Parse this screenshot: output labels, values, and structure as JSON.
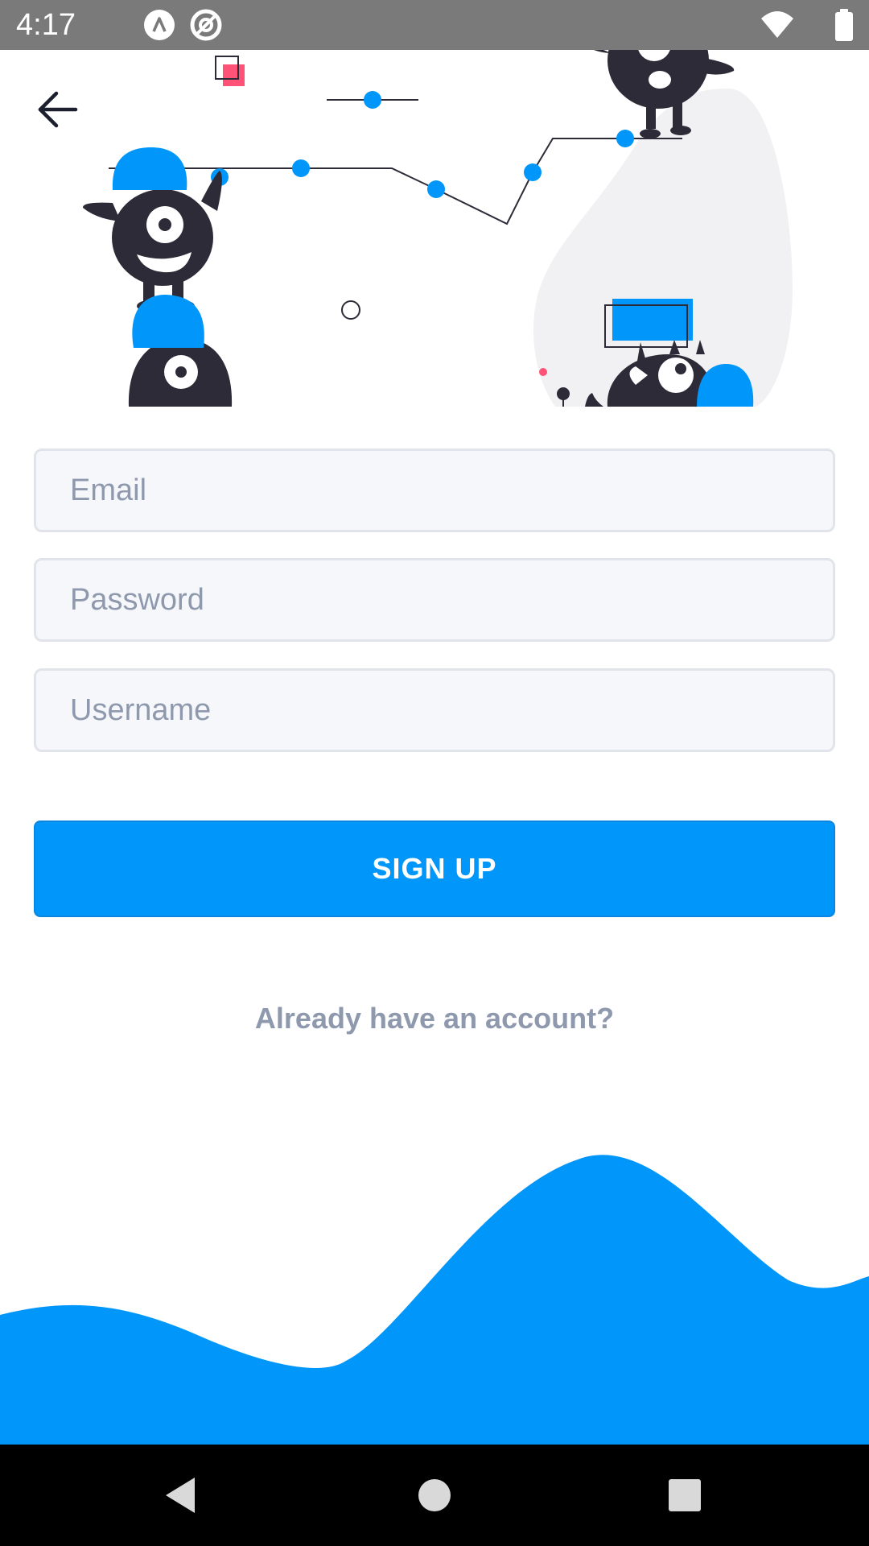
{
  "status_bar": {
    "time": "4:17",
    "icons": [
      "autoplay-notification-icon",
      "blocked-notification-icon",
      "wifi-icon",
      "battery-icon"
    ]
  },
  "header": {
    "back_icon": "arrow-left-icon"
  },
  "form": {
    "email_placeholder": "Email",
    "password_placeholder": "Password",
    "username_placeholder": "Username"
  },
  "actions": {
    "signup_label": "SIGN UP",
    "login_link": "Already have an account?"
  },
  "navigation": {
    "buttons": [
      "back-triangle-icon",
      "home-circle-icon",
      "recents-square-icon"
    ]
  },
  "colors": {
    "primary": "#0096fa",
    "monster": "#2d2b37",
    "muted_text": "#8f99ae",
    "field_background": "#f6f7fb",
    "field_border": "#e2e4ec",
    "accent_pink": "#ff5277"
  }
}
